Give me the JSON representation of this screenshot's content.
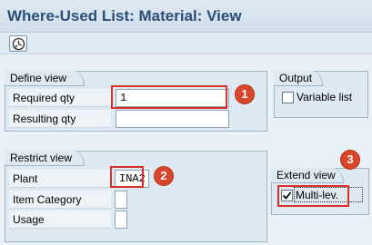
{
  "window": {
    "title": "Where-Used List: Material: View"
  },
  "toolbar": {
    "execute_icon": "clock-execute-icon"
  },
  "define_view": {
    "title": "Define view",
    "required_qty_label": "Required qty",
    "required_qty_value": "1",
    "resulting_qty_label": "Resulting qty",
    "resulting_qty_value": ""
  },
  "restrict_view": {
    "title": "Restrict view",
    "plant_label": "Plant",
    "plant_value": "INA2",
    "item_category_label": "Item Category",
    "item_category_value": "",
    "usage_label": "Usage",
    "usage_value": ""
  },
  "output": {
    "title": "Output",
    "variable_list_label": "Variable list",
    "variable_list_checked": false
  },
  "extend_view": {
    "title": "Extend view",
    "multi_level_label": "Multi-lev.",
    "multi_level_checked": true
  },
  "annotations": {
    "badge1": "1",
    "badge2": "2",
    "badge3": "3",
    "color": "#d9302a"
  }
}
